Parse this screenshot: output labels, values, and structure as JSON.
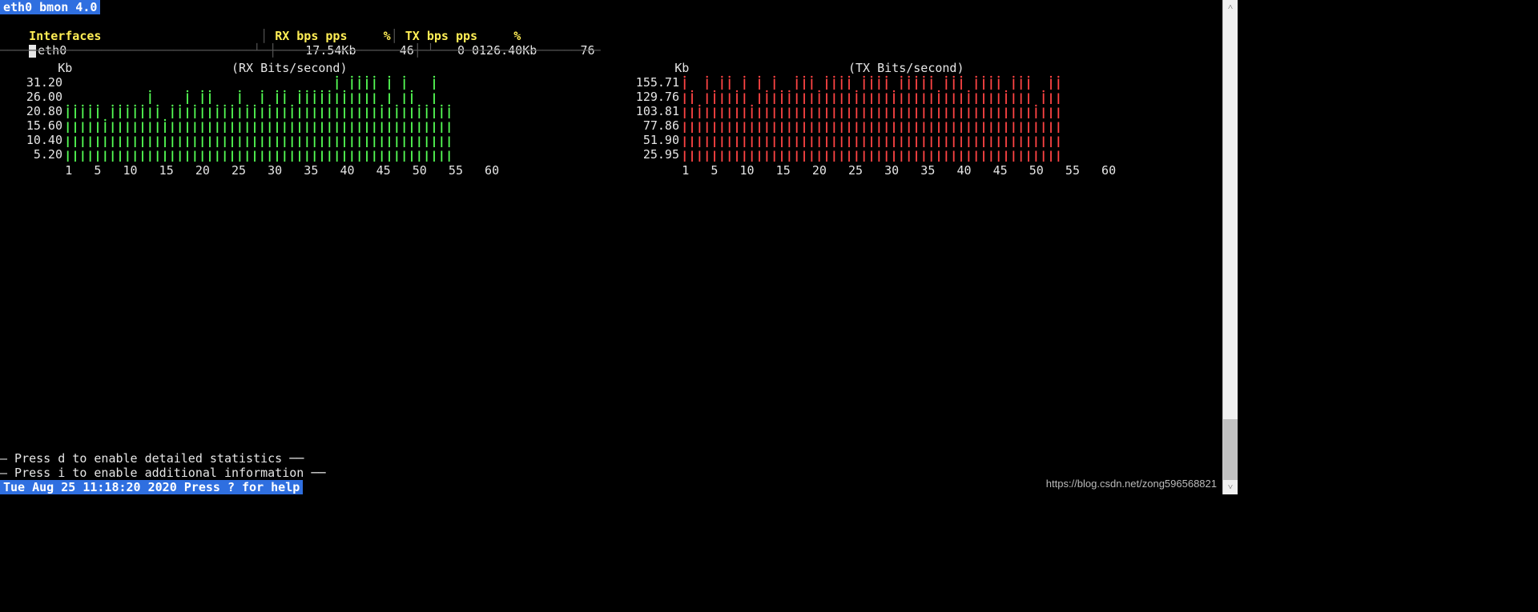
{
  "title": "eth0 bmon 4.0",
  "header": {
    "col_iface": "Interfaces",
    "col_rx": "RX bps pps",
    "col_rx_pct": "%",
    "col_tx": "TX bps pps",
    "col_tx_pct": "%"
  },
  "iface_row": {
    "name": "eth0",
    "rx_bps": "17.54Kb",
    "rx_pps": "46",
    "rx_pct": "0",
    "tx_bps": "0126.40Kb",
    "tx_pps": "76",
    "tx_pct": ""
  },
  "rx": {
    "unit": "Kb",
    "title": "(RX Bits/second)",
    "ylabels": [
      "31.20",
      "26.00",
      "20.80",
      "15.60",
      "10.40",
      "5.20"
    ],
    "color": "#55ff55"
  },
  "tx": {
    "unit": "Kb",
    "title": "(TX Bits/second)",
    "ylabels": [
      "155.71",
      "129.76",
      "103.81",
      "77.86",
      "51.90",
      "25.95"
    ],
    "color": "#ff4444"
  },
  "xaxis_ticks": [
    "1",
    "5",
    "10",
    "15",
    "20",
    "25",
    "30",
    "35",
    "40",
    "45",
    "50",
    "55",
    "60"
  ],
  "footer": {
    "line1": "— Press d to enable detailed statistics ──",
    "line2": "— Press i to enable additional information ──"
  },
  "status": "Tue Aug 25 11:18:20 2020 Press ? for help",
  "watermark": "https://blog.csdn.net/zong596568821",
  "chart_data": [
    {
      "type": "bar",
      "title": "(RX Bits/second)",
      "xlabel": "",
      "ylabel": "Kb",
      "ylim": [
        0,
        31.2
      ],
      "categories_hint": "60 time slots (newest on left)",
      "values": [
        20,
        22,
        23,
        21,
        22,
        17,
        23,
        22,
        21,
        22,
        23,
        24,
        20,
        16,
        21,
        23,
        24,
        23,
        25,
        26,
        20,
        22,
        23,
        24,
        20,
        23,
        24,
        22,
        24,
        24,
        23,
        26,
        27,
        28,
        26,
        27,
        29,
        28,
        30,
        31,
        31,
        32,
        23,
        30,
        21,
        30,
        26,
        22,
        20,
        31,
        21,
        21,
        0,
        0,
        0,
        0,
        0,
        0,
        0,
        0
      ]
    },
    {
      "type": "bar",
      "title": "(TX Bits/second)",
      "xlabel": "",
      "ylabel": "Kb",
      "ylim": [
        0,
        155.71
      ],
      "categories_hint": "60 time slots (newest on left)",
      "values": [
        155,
        130,
        102,
        155,
        130,
        155,
        155,
        130,
        155,
        102,
        155,
        130,
        155,
        130,
        130,
        155,
        155,
        155,
        130,
        155,
        155,
        155,
        155,
        130,
        155,
        155,
        155,
        155,
        130,
        155,
        155,
        155,
        155,
        155,
        130,
        155,
        155,
        155,
        130,
        155,
        155,
        155,
        155,
        130,
        155,
        155,
        155,
        102,
        130,
        155,
        155,
        0,
        0,
        0,
        0,
        0,
        0,
        0,
        0,
        0
      ]
    }
  ]
}
